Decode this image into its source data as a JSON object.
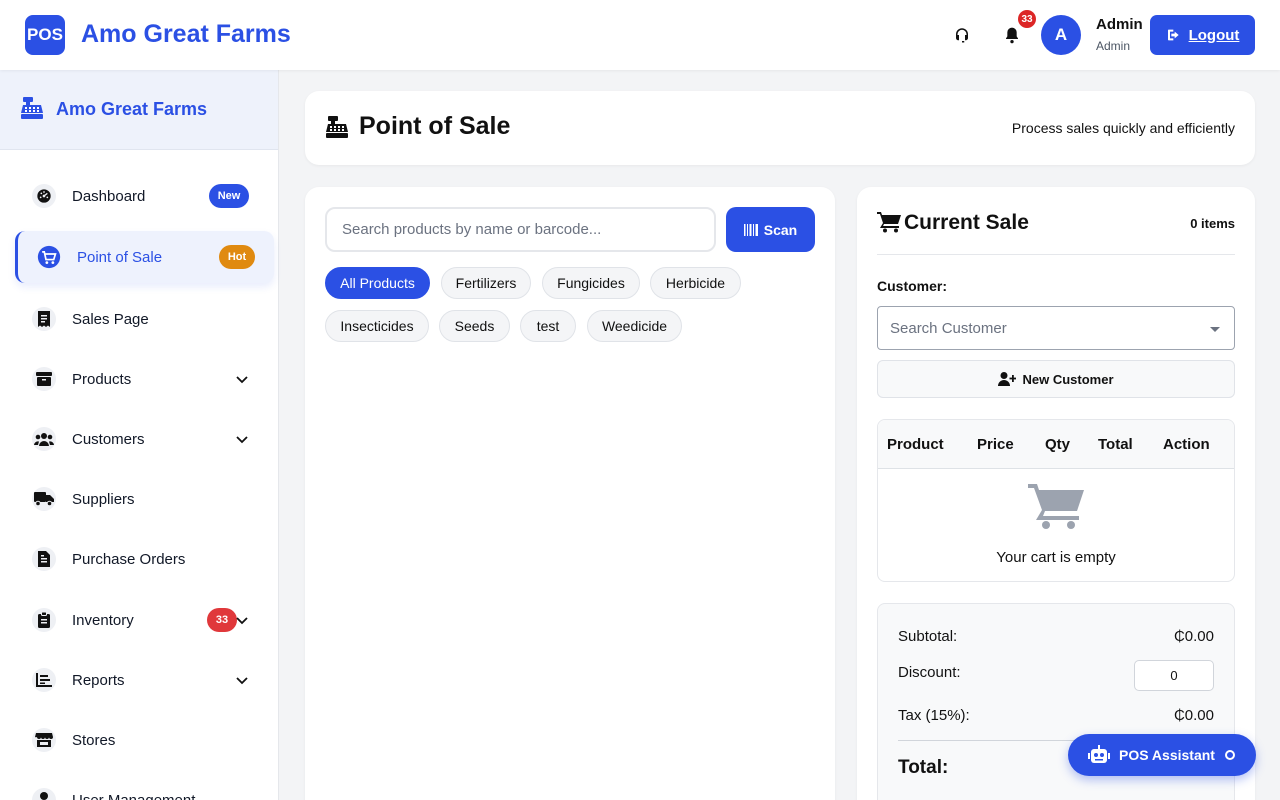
{
  "topbar": {
    "logo_text": "POS",
    "brand": "Amo Great Farms",
    "notification_count": "33",
    "avatar_letter": "A",
    "user_name": "Admin",
    "user_role": "Admin",
    "logout_label": "Logout"
  },
  "sidebar": {
    "title": "Amo Great Farms",
    "items": [
      {
        "label": "Dashboard",
        "icon": "dashboard-icon",
        "badge": "New"
      },
      {
        "label": "Point of Sale",
        "icon": "cart-icon",
        "badge": "Hot",
        "active": true
      },
      {
        "label": "Sales Page",
        "icon": "receipt-icon"
      },
      {
        "label": "Products",
        "icon": "box-icon",
        "expandable": true
      },
      {
        "label": "Customers",
        "icon": "users-icon",
        "expandable": true
      },
      {
        "label": "Suppliers",
        "icon": "truck-icon"
      },
      {
        "label": "Purchase Orders",
        "icon": "file-icon"
      },
      {
        "label": "Inventory",
        "icon": "clipboard-icon",
        "badge": "33",
        "expandable": true
      },
      {
        "label": "Reports",
        "icon": "chart-icon",
        "expandable": true
      },
      {
        "label": "Stores",
        "icon": "store-icon"
      },
      {
        "label": "User Management",
        "icon": "user-icon"
      }
    ]
  },
  "page": {
    "title": "Point of Sale",
    "subtitle": "Process sales quickly and efficiently"
  },
  "products": {
    "search_placeholder": "Search products by name or barcode...",
    "scan_label": "Scan",
    "categories": [
      "All Products",
      "Fertilizers",
      "Fungicides",
      "Herbicide",
      "Insecticides",
      "Seeds",
      "test",
      "Weedicide"
    ],
    "active_category": "All Products"
  },
  "sale": {
    "title": "Current Sale",
    "item_count": "0 items",
    "customer_label": "Customer:",
    "customer_placeholder": "Search Customer",
    "new_customer_label": "New Customer",
    "columns": [
      "Product",
      "Price",
      "Qty",
      "Total",
      "Action"
    ],
    "empty_text": "Your cart is empty",
    "subtotal_label": "Subtotal:",
    "subtotal_value": "₵0.00",
    "discount_label": "Discount:",
    "discount_value": "0",
    "tax_label": "Tax (15%):",
    "tax_value": "₵0.00",
    "total_label": "Total:"
  },
  "assistant": {
    "label": "POS Assistant"
  },
  "colors": {
    "primary": "#2b50e4",
    "hot_badge": "#e08a10",
    "count_badge": "#e0383b"
  }
}
